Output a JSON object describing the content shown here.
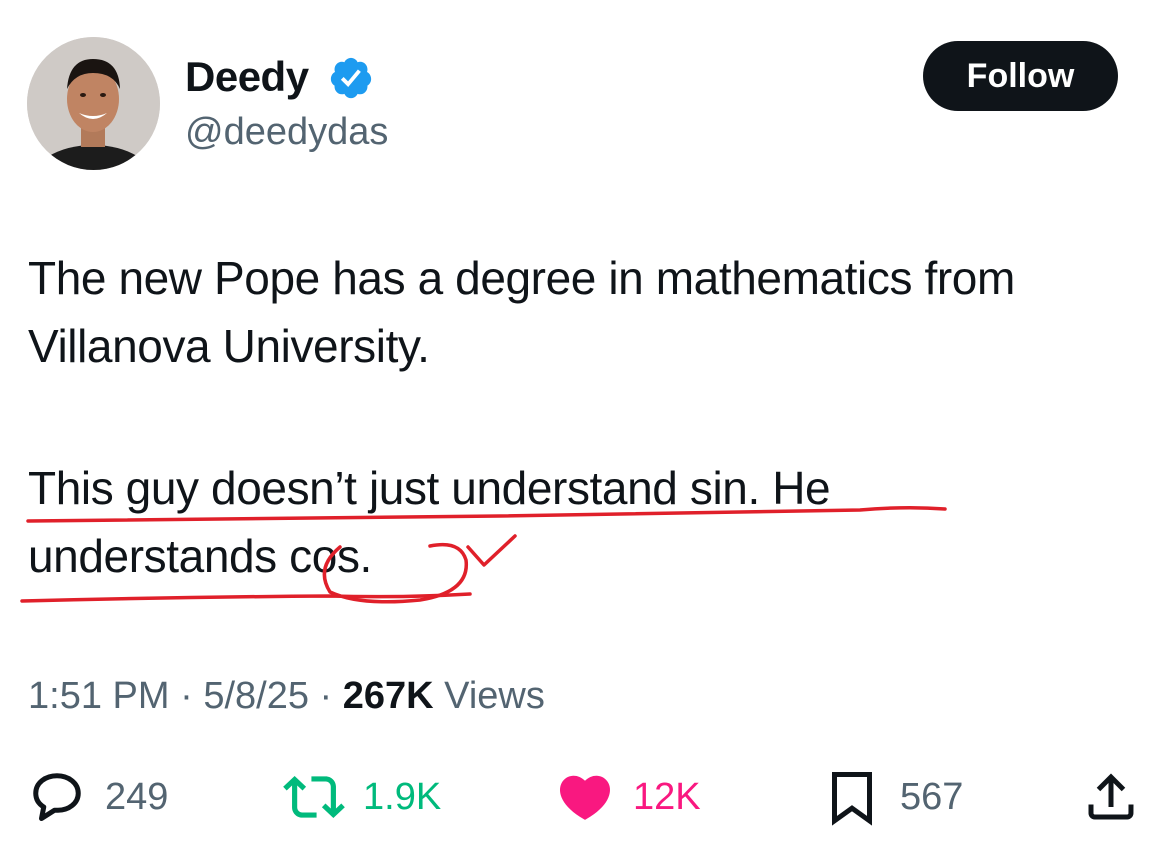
{
  "author": {
    "display_name": "Deedy",
    "handle": "@deedydas",
    "verified_icon": "verified-badge-icon",
    "verified_color": "#1d9bf0"
  },
  "follow_label": "Follow",
  "tweet": {
    "paragraph1": [
      "The new Pope has a degree in mathematics from",
      "Villanova University."
    ],
    "paragraph2": [
      "This guy doesn’t just understand sin. He",
      "understands cos."
    ]
  },
  "meta": {
    "time": "1:51 PM",
    "date": "5/8/25",
    "separator": "·",
    "views_count": "267K",
    "views_label": "Views"
  },
  "actions": {
    "replies": "249",
    "reposts": "1.9K",
    "likes": "12K",
    "bookmarks": "567"
  },
  "colors": {
    "text": "#0f1419",
    "secondary": "#536471",
    "repost": "#00ba7c",
    "like": "#f91880",
    "annotation": "#e0202a"
  }
}
